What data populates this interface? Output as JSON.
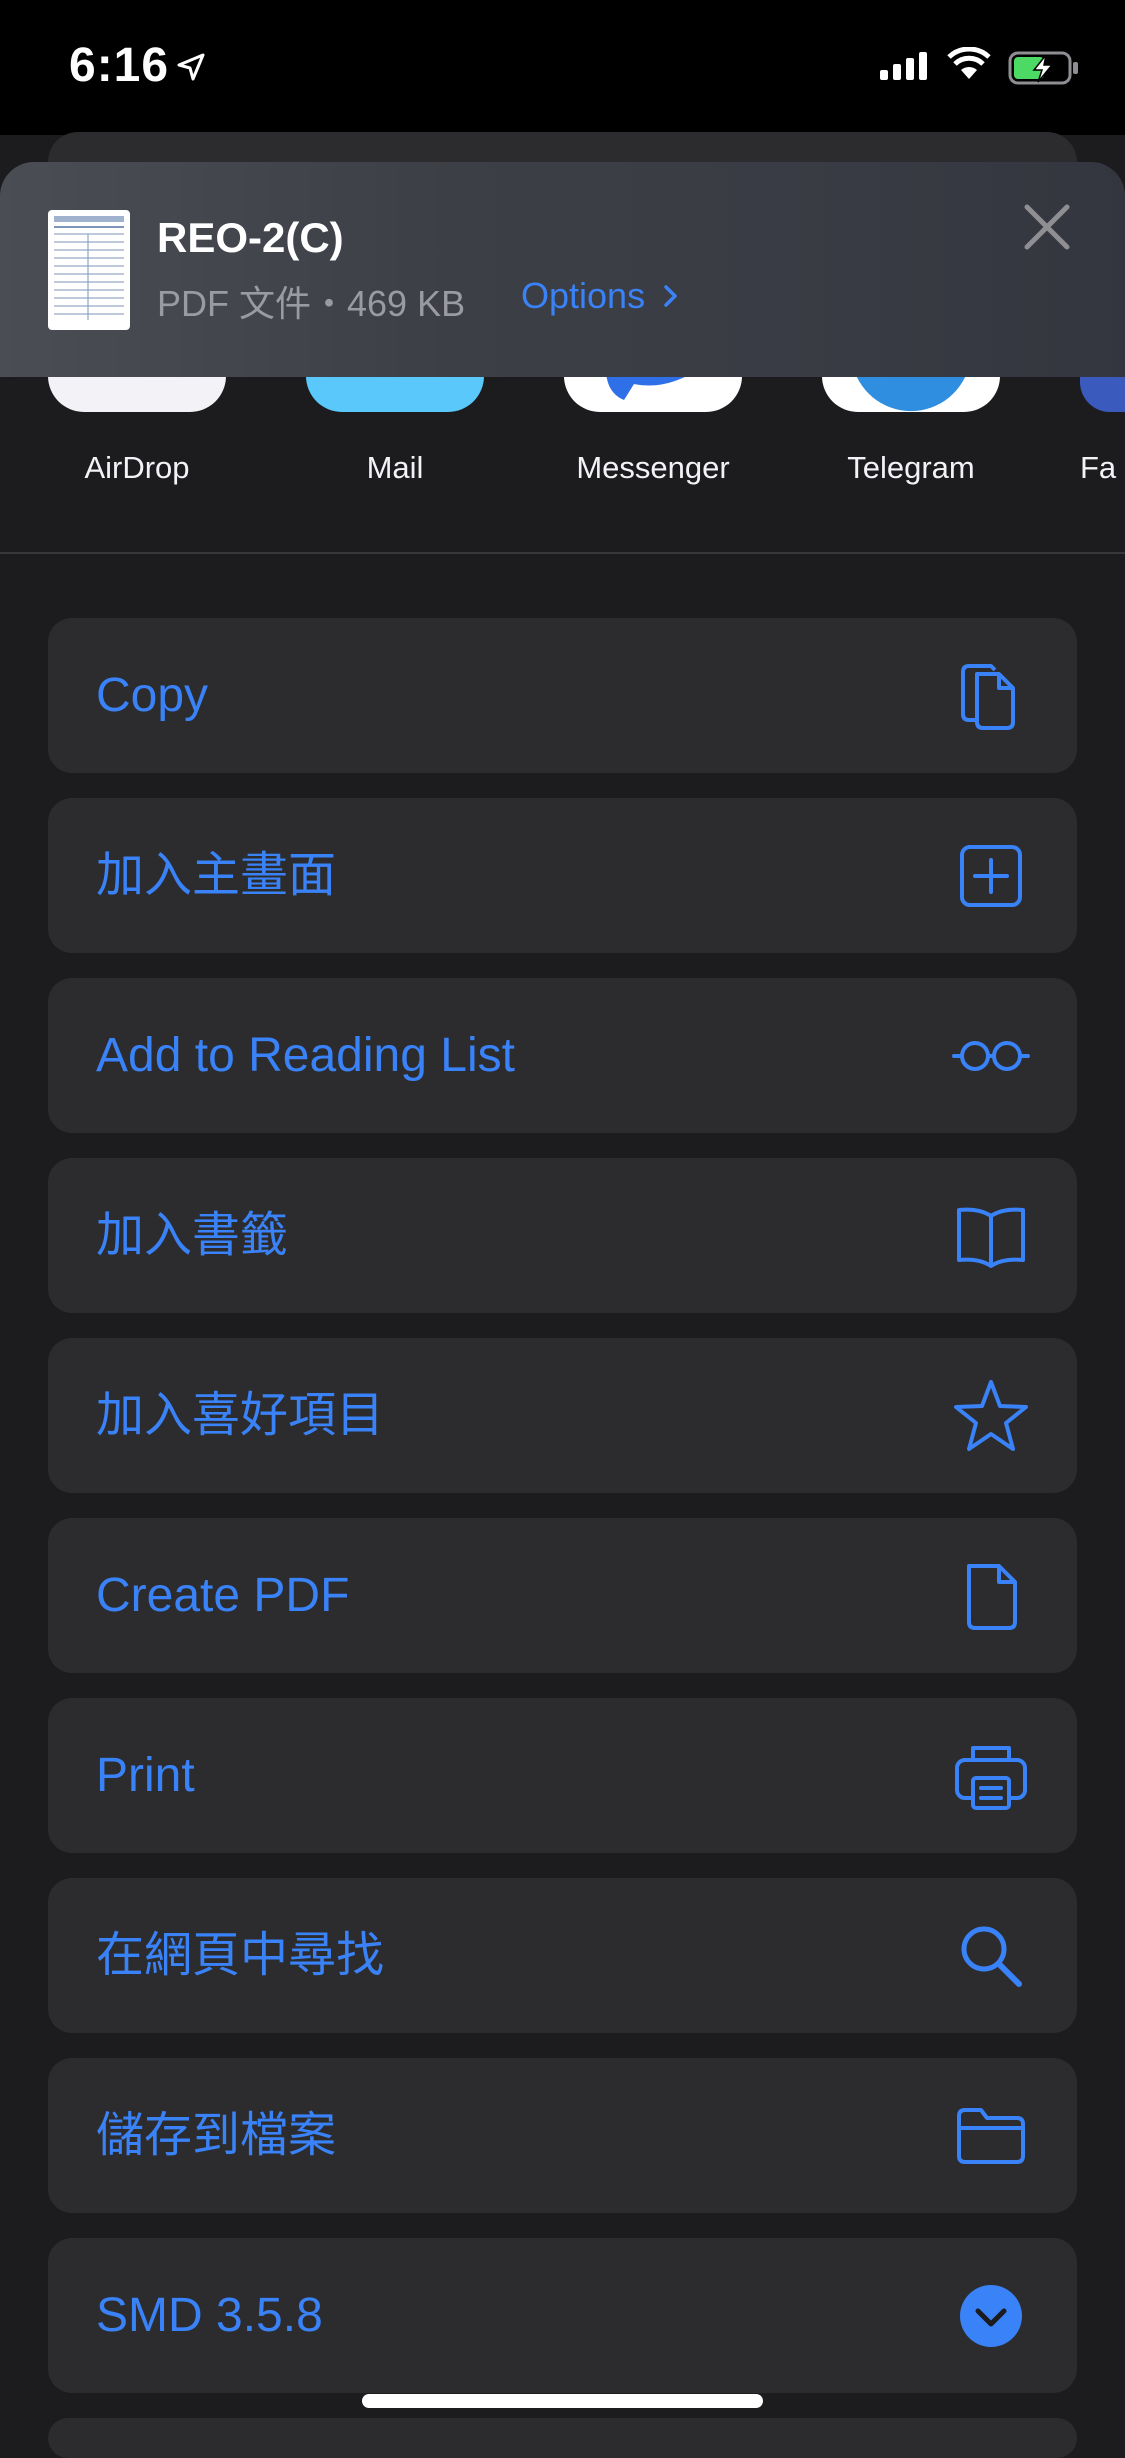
{
  "status_bar": {
    "time": "6:16",
    "icons": [
      "location-arrow-icon",
      "cellular-signal-icon",
      "wifi-icon",
      "battery-charging-icon"
    ]
  },
  "share_header": {
    "title": "REO-2(C)",
    "subtitle": "PDF 文件・469 KB",
    "options_label": "Options",
    "close_icon": "close-icon"
  },
  "apps": [
    {
      "label": "AirDrop"
    },
    {
      "label": "Mail"
    },
    {
      "label": "Messenger"
    },
    {
      "label": "Telegram"
    },
    {
      "label": "Fa"
    }
  ],
  "actions": [
    {
      "label": "Copy",
      "icon": "copy-icon"
    },
    {
      "label": "加入主畫面",
      "icon": "add-square-icon"
    },
    {
      "label": "Add to Reading List",
      "icon": "glasses-icon"
    },
    {
      "label": "加入書籤",
      "icon": "book-icon"
    },
    {
      "label": "加入喜好項目",
      "icon": "star-icon"
    },
    {
      "label": "Create PDF",
      "icon": "document-icon"
    },
    {
      "label": "Print",
      "icon": "printer-icon"
    },
    {
      "label": "在網頁中尋找",
      "icon": "search-icon"
    },
    {
      "label": "儲存到檔案",
      "icon": "folder-icon"
    },
    {
      "label": "SMD 3.5.8",
      "icon": "chevron-down-circle-icon"
    }
  ],
  "colors": {
    "accent": "#3a82f7",
    "row_bg": "#2c2c2e",
    "sheet_bg": "#1c1c1e"
  }
}
